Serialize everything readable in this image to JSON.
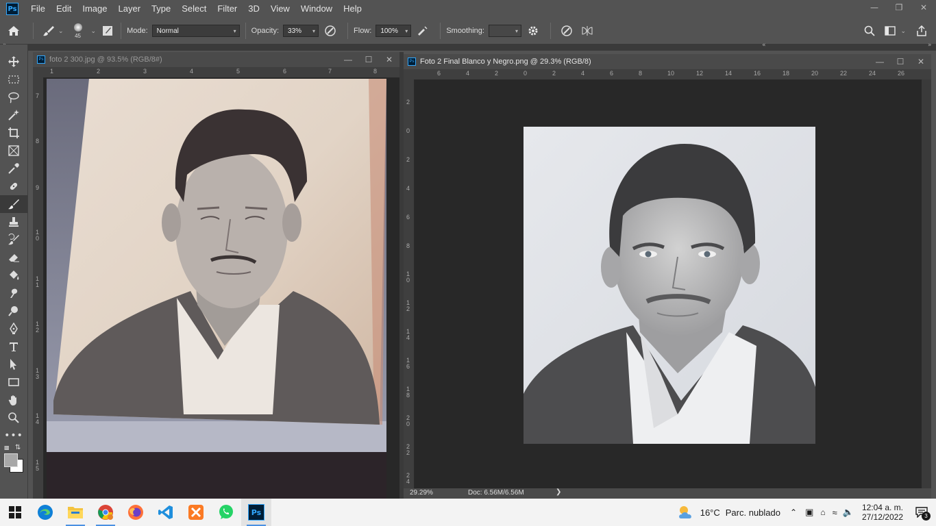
{
  "app": {
    "logo": "Ps",
    "menu": [
      "File",
      "Edit",
      "Image",
      "Layer",
      "Type",
      "Select",
      "Filter",
      "3D",
      "View",
      "Window",
      "Help"
    ]
  },
  "options_bar": {
    "brush_size": "45",
    "mode_label": "Mode:",
    "mode_value": "Normal",
    "opacity_label": "Opacity:",
    "opacity_value": "33%",
    "flow_label": "Flow:",
    "flow_value": "100%",
    "smoothing_label": "Smoothing:",
    "smoothing_value": ""
  },
  "toolbar": {
    "tools": [
      "move-icon",
      "marquee-icon",
      "lasso-icon",
      "magic-wand-icon",
      "crop-icon",
      "frame-icon",
      "eyedropper-icon",
      "healing-icon",
      "brush-icon",
      "stamp-icon",
      "history-brush-icon",
      "eraser-icon",
      "paint-bucket-icon",
      "smudge-icon",
      "dodge-icon",
      "pen-icon",
      "type-icon",
      "path-select-icon",
      "rectangle-icon",
      "hand-icon",
      "zoom-icon",
      "more-icon"
    ],
    "active_tool": "brush-icon"
  },
  "documents": [
    {
      "title": "foto 2 300.jpg @ 93.5% (RGB/8#)",
      "ruler_h": [
        "1",
        "2",
        "3",
        "4",
        "5",
        "6",
        "7",
        "8"
      ],
      "ruler_v": [
        "7",
        "8",
        "9",
        "1 0",
        "1 1",
        "1 2",
        "1 3",
        "1 4",
        "1 5"
      ]
    },
    {
      "title": "Foto 2 Final Blanco y Negro.png @ 29.3% (RGB/8)",
      "ruler_h": [
        "6",
        "4",
        "2",
        "0",
        "2",
        "4",
        "6",
        "8",
        "10",
        "12",
        "14",
        "16",
        "18",
        "20",
        "22",
        "24",
        "26"
      ],
      "ruler_v": [
        "2",
        "0",
        "2",
        "4",
        "6",
        "8",
        "1 0",
        "1 2",
        "1 4",
        "1 6",
        "1 8",
        "2 0",
        "2 2",
        "2 4"
      ],
      "status_zoom": "29.29%",
      "status_doc": "Doc: 6.56M/6.56M"
    }
  ],
  "taskbar": {
    "apps": [
      "windows-start-icon",
      "edge-icon",
      "file-explorer-icon",
      "chrome-icon",
      "firefox-icon",
      "vscode-icon",
      "xampp-icon",
      "whatsapp-icon",
      "photoshop-icon"
    ],
    "weather_temp": "16°C",
    "weather_desc": "Parc. nublado",
    "time": "12:04 a. m.",
    "date": "27/12/2022",
    "notifications": "3"
  }
}
